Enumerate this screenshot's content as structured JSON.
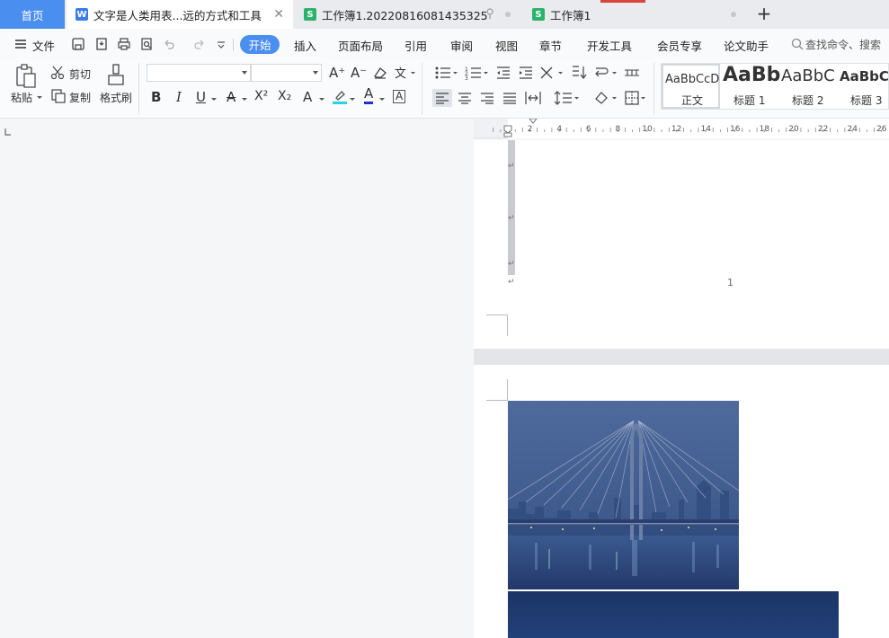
{
  "tabs": {
    "home": "首页",
    "doc": "文字是人类用表...远的方式和工具",
    "sheet1": "工作簿1.20220816081435325",
    "sheet2": "工作簿1",
    "doc_icon": "W",
    "sheet_icon": "S",
    "close": "✕",
    "add": "+"
  },
  "menu": {
    "file": "文件",
    "start": "开始",
    "insert": "插入",
    "layout": "页面布局",
    "reference": "引用",
    "review": "审阅",
    "view": "视图",
    "chapter": "章节",
    "dev": "开发工具",
    "vip": "会员专享",
    "thesis": "论文助手",
    "search": "查找命令、搜索"
  },
  "ribbon": {
    "paste": "粘贴",
    "cut": "剪切",
    "copy": "复制",
    "format_painter": "格式刷",
    "font_name": "",
    "font_size": "",
    "grow_font": "A⁺",
    "shrink_font": "A⁻",
    "bold": "B",
    "italic": "I",
    "underline": "U",
    "strike": "A",
    "superscript": "X²",
    "subscript": "X₂",
    "effect": "A",
    "font_color": "A",
    "char_border": "A"
  },
  "styles": [
    {
      "preview": "AaBbCcD",
      "name": "正文"
    },
    {
      "preview": "AaBb",
      "name": "标题 1"
    },
    {
      "preview": "AaBbC",
      "name": "标题 2"
    },
    {
      "preview": "AaBbCc",
      "name": "标题 3"
    }
  ],
  "ruler": {
    "ticks": [
      "2",
      "4",
      "6",
      "8",
      "10",
      "12",
      "14",
      "16",
      "18",
      "20",
      "22",
      "24",
      "26"
    ]
  },
  "document": {
    "page_number": "1",
    "para_mark": "↵"
  },
  "colors": {
    "accent": "#4a8ef0",
    "word_icon": "#3b7de8",
    "sheet_icon": "#2cb36b",
    "highlight": "#2ad4e8",
    "font_color": "#2233cc"
  }
}
